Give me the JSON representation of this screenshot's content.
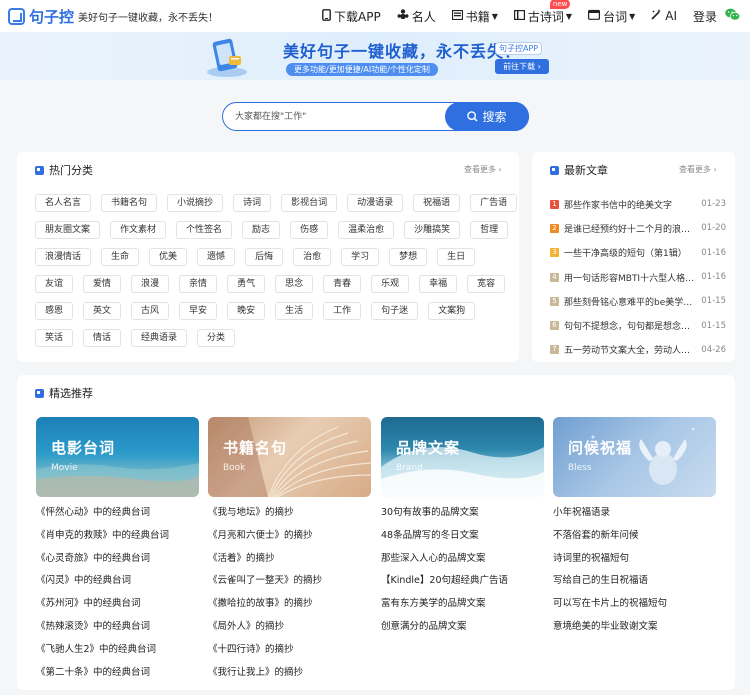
{
  "header": {
    "logo": "句子控",
    "slogan": "美好句子一键收藏，永不丢失！",
    "nav": [
      {
        "label": "下载APP",
        "icon": "phone-icon"
      },
      {
        "label": "名人",
        "icon": "people-icon"
      },
      {
        "label": "书籍",
        "icon": "book-icon",
        "dropdown": true
      },
      {
        "label": "古诗词",
        "icon": "scroll-icon",
        "dropdown": true,
        "badge": "new"
      },
      {
        "label": "台词",
        "icon": "screen-icon",
        "dropdown": true
      },
      {
        "label": "AI",
        "icon": "magic-wand-icon"
      },
      {
        "label": "登录"
      }
    ]
  },
  "banner": {
    "title": "美好句子一键收藏，永不丢失！",
    "subtitle": "更多功能/更加便捷/AI功能/个性化定制",
    "app_name": "句子控APP",
    "download": "前往下载 ›"
  },
  "search": {
    "placeholder": "大家都在搜\"工作\"",
    "button": "搜索"
  },
  "hot": {
    "title": "热门分类",
    "more": "查看更多 ›",
    "rows": [
      [
        "名人名言",
        "书籍名句",
        "小说摘抄",
        "诗词",
        "影视台词",
        "动漫语录",
        "祝福语",
        "广告语"
      ],
      [
        "朋友圈文案",
        "作文素材",
        "个性签名",
        "励志",
        "伤感",
        "温柔治愈",
        "沙雕搞笑",
        "哲理"
      ],
      [
        "浪漫情话",
        "生命",
        "优美",
        "遗憾",
        "后悔",
        "治愈",
        "学习",
        "梦想",
        "生日"
      ],
      [
        "友谊",
        "爱情",
        "浪漫",
        "亲情",
        "勇气",
        "思念",
        "青春",
        "乐观",
        "幸福",
        "宽容"
      ],
      [
        "感恩",
        "英文",
        "古风",
        "早安",
        "晚安",
        "生活",
        "工作",
        "句子迷",
        "文案狗"
      ],
      [
        "笑话",
        "情话",
        "经典语录",
        "分类"
      ]
    ]
  },
  "latest": {
    "title": "最新文章",
    "more": "查看更多 ›",
    "items": [
      {
        "n": "1",
        "title": "那些作家书信中的绝美文字",
        "date": "01-23"
      },
      {
        "n": "2",
        "title": "是谁已经预约好十二个月的浪漫了",
        "date": "01-20"
      },
      {
        "n": "3",
        "title": "一些干净高级的短句（第1辑）",
        "date": "01-16"
      },
      {
        "n": "4",
        "title": "用一句话形容MBTI十六型人格特点",
        "date": "01-16"
      },
      {
        "n": "5",
        "title": "那些刻骨铭心意难平的be美学语录",
        "date": "01-15"
      },
      {
        "n": "6",
        "title": "句句不提想念，句句都是想念一个人",
        "date": "01-15"
      },
      {
        "n": "7",
        "title": "五一劳动节文案大全，劳动人民最光荣",
        "date": "04-26"
      }
    ],
    "colors": [
      "#e8533f",
      "#f08a24",
      "#f2b233",
      "#c8b89a",
      "#c8b89a",
      "#c8b89a",
      "#c8b89a"
    ]
  },
  "featured": {
    "title": "精选推荐",
    "columns": [
      {
        "title": "电影台词",
        "sub": "Movie",
        "items": [
          "《怦然心动》中的经典台词",
          "《肖申克的救赎》中的经典台词",
          "《心灵奇旅》中的经典台词",
          "《闪灵》中的经典台词",
          "《苏州河》中的经典台词",
          "《热辣滚烫》中的经典台词",
          "《飞驰人生2》中的经典台词",
          "《第二十条》中的经典台词"
        ]
      },
      {
        "title": "书籍名句",
        "sub": "Book",
        "items": [
          "《我与地坛》的摘抄",
          "《月亮和六便士》的摘抄",
          "《活着》的摘抄",
          "《云雀叫了一整天》的摘抄",
          "《撒哈拉的故事》的摘抄",
          "《局外人》的摘抄",
          "《十四行诗》的摘抄",
          "《我行让我上》的摘抄"
        ]
      },
      {
        "title": "品牌文案",
        "sub": "Brand",
        "items": [
          "30句有故事的品牌文案",
          "48条品牌写的冬日文案",
          "那些深入人心的品牌文案",
          "【Kindle】20句超经典广告语",
          "富有东方美学的品牌文案",
          "创意满分的品牌文案"
        ]
      },
      {
        "title": "问候祝福",
        "sub": "Bless",
        "items": [
          "小年祝福语录",
          "不落俗套的新年问候",
          "诗词里的祝福短句",
          "写给自己的生日祝福语",
          "可以写在卡片上的祝福短句",
          "意境绝美的毕业致谢文案"
        ]
      }
    ]
  }
}
